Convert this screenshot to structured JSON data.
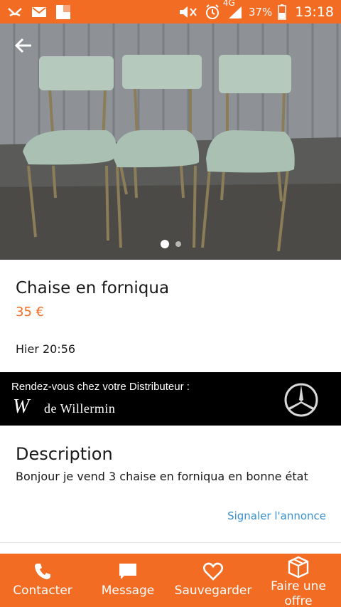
{
  "status_bar": {
    "network": "4G",
    "battery_percent": "37%",
    "time": "13:18"
  },
  "listing": {
    "title": "Chaise en forniqua",
    "price": "35 €",
    "date": "Hier 20:56",
    "photo_count": 2,
    "photo_index": 1
  },
  "ad": {
    "headline": "Rendez-vous chez votre Distributeur :",
    "logo_mark": "W",
    "logo_name": "de Willermin"
  },
  "description": {
    "heading": "Description",
    "text": "Bonjour je vend 3 chaise en forniqua en bonne état",
    "report_link": "Signaler l'annonce"
  },
  "actions": [
    {
      "label": "Contacter",
      "icon": "phone-icon"
    },
    {
      "label": "Message",
      "icon": "message-icon"
    },
    {
      "label": "Sauvegarder",
      "icon": "heart-icon"
    },
    {
      "label": "Faire une offre",
      "icon": "box-icon"
    }
  ],
  "colors": {
    "accent": "#f26c23",
    "link": "#3a8fd0"
  }
}
